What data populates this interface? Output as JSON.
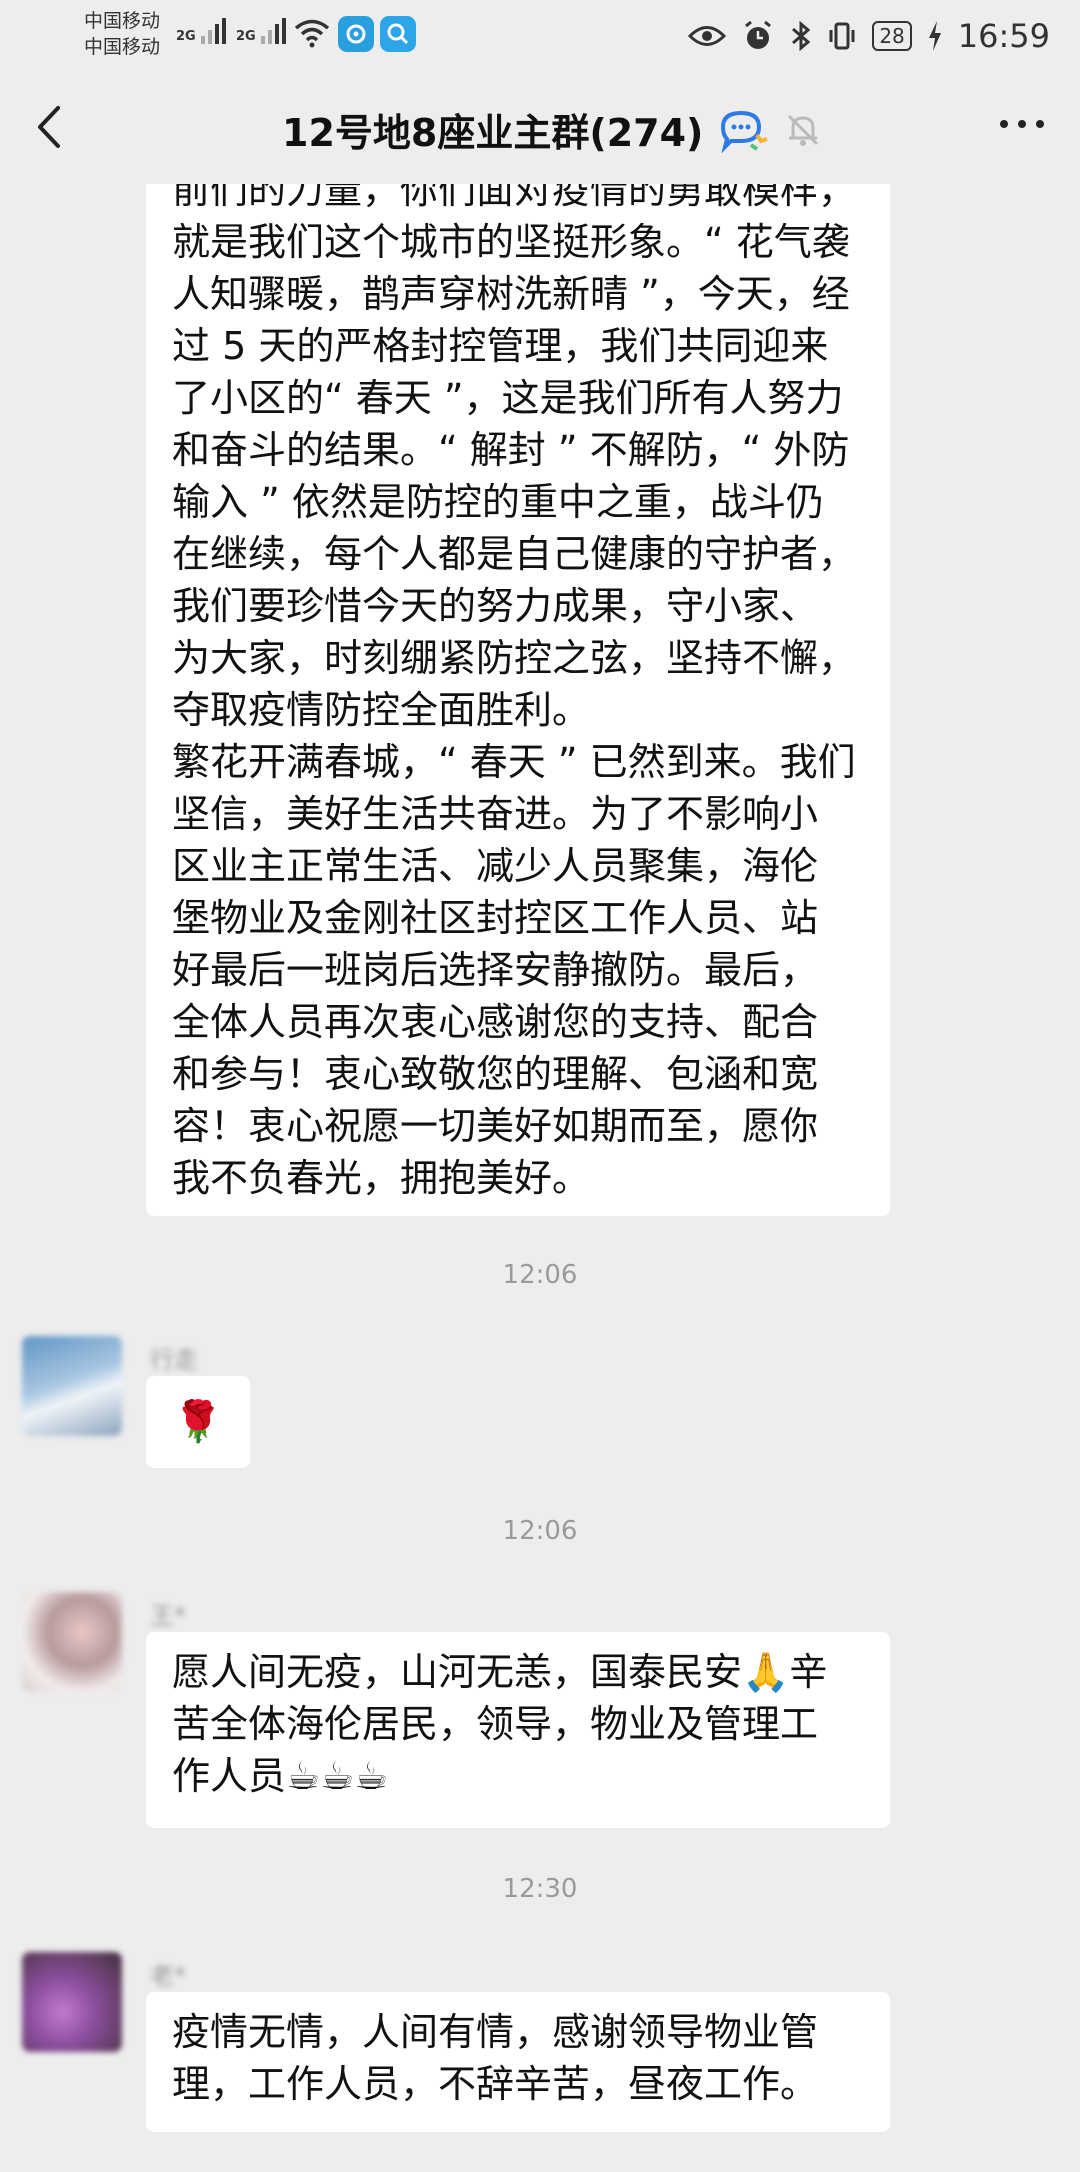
{
  "status_bar": {
    "carrier_1": "中国移动",
    "carrier_2": "中国移动",
    "signal_1": "2G",
    "signal_2": "2G",
    "battery": "28",
    "time": "16:59"
  },
  "header": {
    "title": "12号地8座业主群(274)",
    "back_icon": "chevron-left-icon",
    "ai_icon": "chat-assistant-icon",
    "mute_icon": "bell-mute-icon",
    "more_icon": "more-dots-icon"
  },
  "messages": [
    {
      "type": "text",
      "text": "前们的力量，你们面对疫情的勇敢模样，\n就是我们这个城市的坚挺形象。“ 花气袭\n人知骤暖，鹊声穿树洗新晴 ”，今天，经\n过 5 天的严格封控管理，我们共同迎来\n了小区的“ 春天 ”，这是我们所有人努力\n和奋斗的结果。“ 解封 ” 不解防，“ 外防\n输入 ” 依然是防控的重中之重，战斗仍\n在继续，每个人都是自己健康的守护者，\n我们要珍惜今天的努力成果，守小家、\n为大家，时刻绷紧防控之弦，坚持不懈，\n夺取疫情防控全面胜利。\n繁花开满春城，“ 春天 ” 已然到来。我们\n坚信，美好生活共奋进。为了不影响小\n区业主正常生活、减少人员聚集，海伦\n堡物业及金刚社区封控区工作人员、站\n好最后一班岗后选择安静撤防。最后，\n全体人员再次衷心感谢您的支持、配合\n和参与！衷心致敬您的理解、包涵和宽\n容！衷心祝愿一切美好如期而至，愿你\n我不负春光，拥抱美好。"
    },
    {
      "type": "time",
      "text": "12:06"
    },
    {
      "type": "text",
      "sender": "行走",
      "text": "🌹"
    },
    {
      "type": "time",
      "text": "12:06"
    },
    {
      "type": "text",
      "sender": "王*",
      "text": "愿人间无疫，山河无恙，国泰民安🙏辛\n苦全体海伦居民，领导，物业及管理工\n作人员☕☕☕"
    },
    {
      "type": "time",
      "text": "12:30"
    },
    {
      "type": "text",
      "sender": "老*",
      "text": "疫情无情，人间有情，感谢领导物业管\n理，工作人员，不辞辛苦，昼夜工作。"
    }
  ]
}
